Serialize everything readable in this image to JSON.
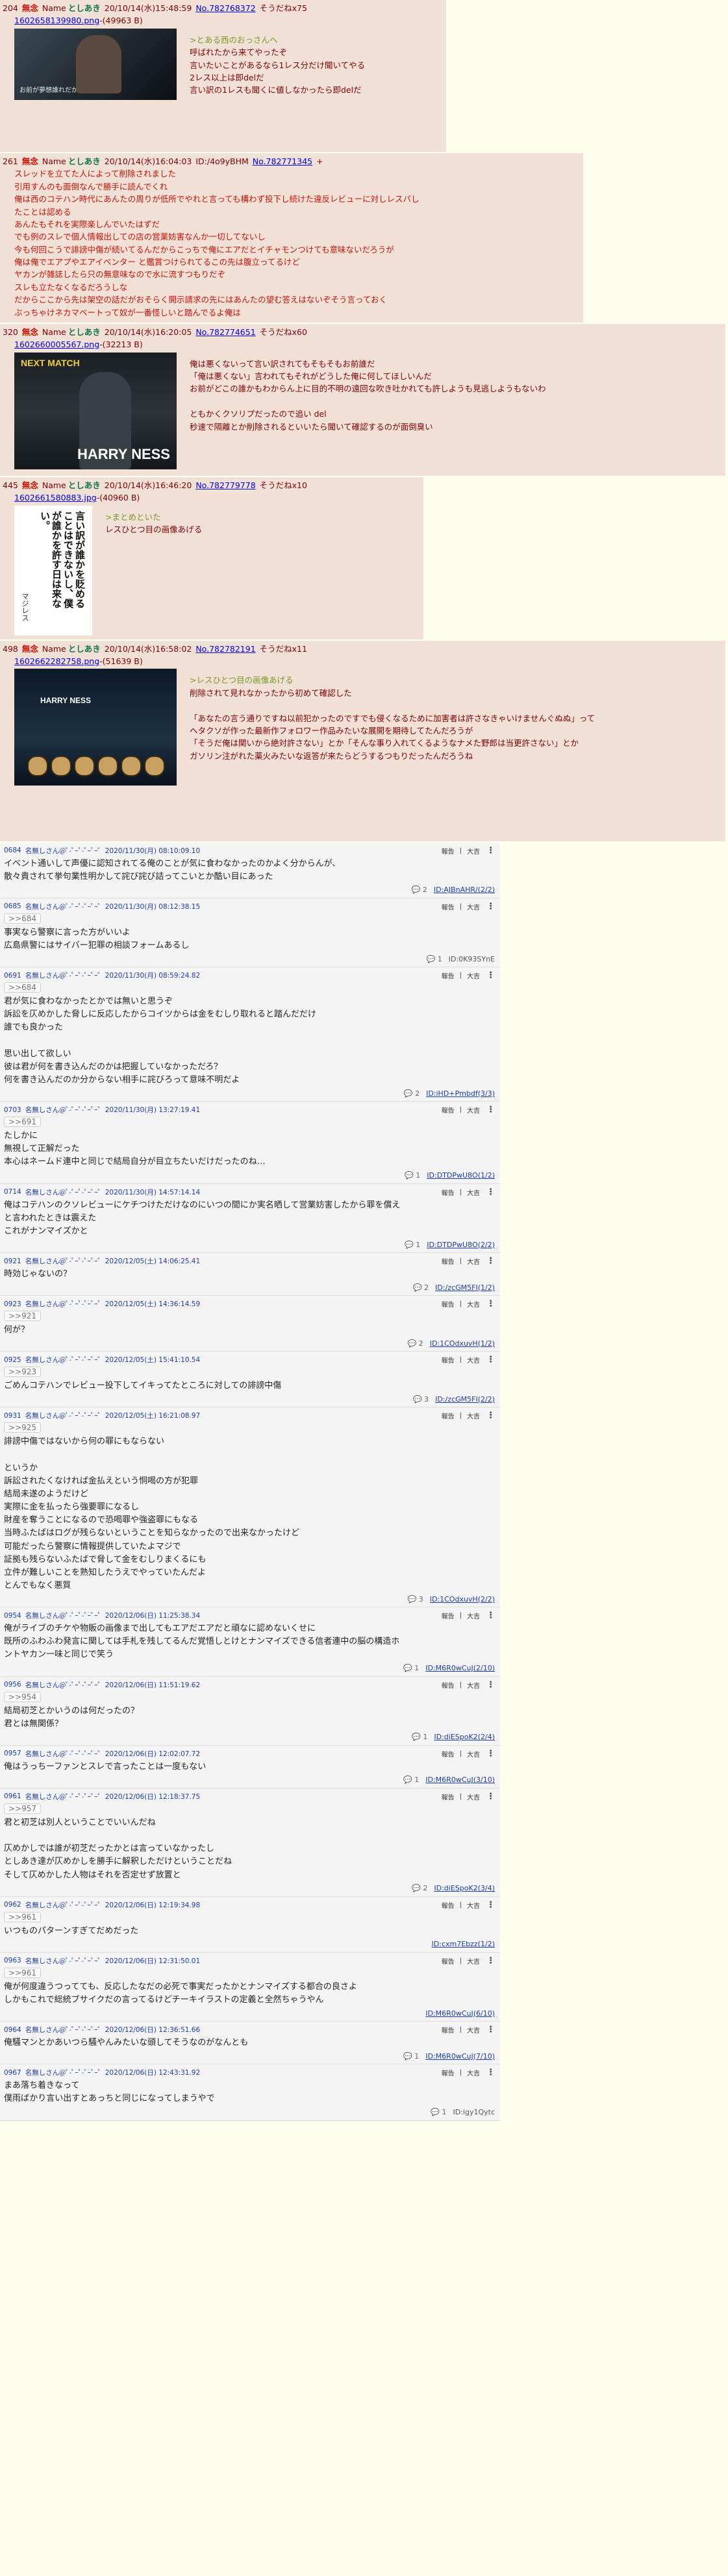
{
  "chan_posts": [
    {
      "num": "204",
      "subject": "無念",
      "name_label": "Name",
      "name": "としあき",
      "datetime": "20/10/14(水)15:48:59",
      "no": "No.782768372",
      "del": "そうだねx75",
      "file": "1602658139980.png",
      "fsize": "-(49963 B)",
      "img_caption": "お前が夢想誰れだかお前わ ...",
      "lines": [
        {
          "t": "q",
          "s": ">とある西のおっさんへ"
        },
        {
          "t": "n",
          "s": "呼ばれたから来てやったぞ"
        },
        {
          "t": "n",
          "s": "言いたいことがあるなら1レス分だけ聞いてやる"
        },
        {
          "t": "n",
          "s": "2レス以上は即delだ"
        },
        {
          "t": "n",
          "s": "言い訳の1レスも聞くに値しなかったら即delだ"
        }
      ]
    },
    {
      "num": "261",
      "subject": "無念",
      "name_label": "Name",
      "name": "としあき",
      "datetime": "20/10/14(水)16:04:03",
      "id": "ID:/4o9yBHM",
      "no": "No.782771345",
      "plus": "+",
      "lines": [
        {
          "t": "r",
          "s": "スレッドを立てた人によって削除されました"
        },
        {
          "t": "r",
          "s": "引用すんのも面倒なんで勝手に読んでくれ"
        },
        {
          "t": "r",
          "s": "俺は西のコテハン時代にあんたの周りが低所でやれと言っても構わず投下し続けた違反レビューに対しレスバし"
        },
        {
          "t": "r",
          "s": "たことは認める"
        },
        {
          "t": "r",
          "s": "あんたもそれを実際楽しんでいたはずだ"
        },
        {
          "t": "r",
          "s": "でも例のスレで個人情報出しての店の営業妨害なんか一切してないし"
        },
        {
          "t": "r",
          "s": "今も何回こうで誹謗中傷が続いてるんだからこっちで俺にエアだとイチャモンつけても意味ないだろうが"
        },
        {
          "t": "r",
          "s": "俺は俺でエアプやエアイベンター と鑑賞つけられてるこの先は腹立ってるけど"
        },
        {
          "t": "r",
          "s": "ヤカンが雑誌したら只の無意味なので水に流すつもりだぞ"
        },
        {
          "t": "r",
          "s": "スレも立たなくなるだろうしな"
        },
        {
          "t": "r",
          "s": "だからここから先は架空の話だがおそらく開示請求の先にはあんたの望む答えはないぞそう言っておく"
        },
        {
          "t": "r",
          "s": "ぶっちゃけネカマベートって奴が一番怪しいと踏んでるよ俺は"
        }
      ]
    },
    {
      "num": "320",
      "subject": "無念",
      "name_label": "Name",
      "name": "としあき",
      "datetime": "20/10/14(水)16:20:05",
      "no": "No.782774651",
      "del": "そうだねx60",
      "file": "1602660005567.png",
      "fsize": "-(32213 B)",
      "img_top": "NEXT MATCH",
      "img_name": "HARRY NESS",
      "lines": [
        {
          "t": "n",
          "s": "俺は悪くないって言い訳されてもそもそもお前誰だ"
        },
        {
          "t": "n",
          "s": "「俺は悪くない」言われてもそれがどうした俺に何してほしいんだ"
        },
        {
          "t": "n",
          "s": "お前がどこの誰かもわからん上に目的不明の遠回な吹き吐かれても許しようも見逃しようもないわ"
        },
        {
          "t": "n",
          "s": " "
        },
        {
          "t": "n",
          "s": "ともかくクソリプだったので追い del"
        },
        {
          "t": "n",
          "s": "秒速で隔離とか削除されるといいたら聞いて確認するのが面倒臭い"
        }
      ]
    },
    {
      "num": "445",
      "subject": "無念",
      "name_label": "Name",
      "name": "としあき",
      "datetime": "20/10/14(水)16:46:20",
      "no": "No.782779778",
      "del": "そうだねx10",
      "file": "1602661580883.jpg",
      "fsize": "-(40960 B)",
      "img_text": "言い訳が誰かを貶めることはできないし、僕が誰かを許す日は来ない。",
      "img_sig": "マジレス",
      "lines": [
        {
          "t": "q",
          "s": ">まとめといた"
        },
        {
          "t": "n",
          "s": "レスひとつ目の画像あげる"
        }
      ]
    },
    {
      "num": "498",
      "subject": "無念",
      "name_label": "Name",
      "name": "としあき",
      "datetime": "20/10/14(水)16:58:02",
      "no": "No.782782191",
      "del": "そうだねx11",
      "file": "1602662282758.png",
      "fsize": "-(51639 B)",
      "img_name": "HARRY NESS",
      "lines": [
        {
          "t": "q",
          "s": ">レスひとつ目の画像あげる"
        },
        {
          "t": "n",
          "s": "削除されて見れなかったから初めて確認した"
        },
        {
          "t": "n",
          "s": " "
        },
        {
          "t": "n",
          "s": "「あなたの言う通りですね以前犯かったのですでも侵くなるために加害者は許さなきゃいけませんぐぬぬ」って"
        },
        {
          "t": "n",
          "s": "ヘタクソが作った最新作フォロワー作品みたいな展開を期待してたんだろうが"
        },
        {
          "t": "n",
          "s": "「そうだ俺は関いから絶対許さない」とか「そんな事り入れてくるようなナメた野郎は当更許さない」とか"
        },
        {
          "t": "n",
          "s": "ガソリン注がれた薬火みたいな返答が来たらどうするつもりだったんだろうね"
        }
      ]
    }
  ],
  "res_posts": [
    {
      "no": "0684",
      "name": "名無しさん@ﾟ-ﾟｰﾟ-ﾟｰﾟｰﾟ",
      "date": "2020/11/30(月) 08:10:09.10",
      "quote": "",
      "body": "イベント通いして声優に認知されてる俺のことが気に食わなかったのかよく分からんが、\n散々貴されて挙句業性明かして詫び詫び詰ってこいとか酷い目にあった",
      "count": "2",
      "uid": "ID:AJBnAHR/(2/2)"
    },
    {
      "no": "0685",
      "name": "名無しさん@ﾟ-ﾟｰﾟ-ﾟｰﾟｰﾟ",
      "date": "2020/11/30(月) 08:12:38.15",
      "quote": ">>684",
      "body": "事実なら警察に言った方がいいよ\n広島県警にはサイバー犯罪の相談フォームあるし",
      "count": "1",
      "uid": "ID:0K93SYnE",
      "uid_plain": true
    },
    {
      "no": "0691",
      "name": "名無しさん@ﾟ-ﾟｰﾟ-ﾟｰﾟｰﾟ",
      "date": "2020/11/30(月) 08:59:24.82",
      "quote": ">>684",
      "body": "君が気に食わなかったとかでは無いと思うぞ\n訴訟を仄めかした脅しに反応したからコイツからは金をむしり取れると踏んだだけ\n誰でも良かった\n\n思い出して欲しい\n彼は君が何を書き込んだのかは把握していなかっただろ？\n何を書き込んだのか分からない相手に詫びろって意味不明だよ",
      "count": "2",
      "uid": "ID:iHD+Pmbdf(3/3)"
    },
    {
      "no": "0703",
      "name": "名無しさん@ﾟ-ﾟｰﾟ-ﾟｰﾟｰﾟ",
      "date": "2020/11/30(月) 13:27:19.41",
      "quote": ">>691",
      "body": "たしかに\n無視して正解だった\n本心はネームド連中と同じで結局自分が目立ちたいだけだったのね…",
      "count": "1",
      "uid": "ID:DTDPwU8O(1/2)"
    },
    {
      "no": "0714",
      "name": "名無しさん@ﾟ-ﾟｰﾟ-ﾟｰﾟｰﾟ",
      "date": "2020/11/30(月) 14:57:14.14",
      "quote": "",
      "body": "俺はコテハンのクソレビューにケチつけただけなのにいつの間にか実名晒して営業妨害したから罪を償え\nと言われたときは震えた\nこれがナンマイズかと",
      "count": "1",
      "uid": "ID:DTDPwU8O(2/2)"
    },
    {
      "no": "0921",
      "name": "名無しさん@ﾟ-ﾟｰﾟ-ﾟｰﾟｰﾟ",
      "date": "2020/12/05(土) 14:06:25.41",
      "quote": "",
      "body": "時効じゃないの？",
      "count": "2",
      "uid": "ID:/zcGM5FI(1/2)"
    },
    {
      "no": "0923",
      "name": "名無しさん@ﾟ-ﾟｰﾟ-ﾟｰﾟｰﾟ",
      "date": "2020/12/05(土) 14:36:14.59",
      "quote": ">>921",
      "body": "何が？",
      "count": "2",
      "uid": "ID:1COdxuvH(1/2)"
    },
    {
      "no": "0925",
      "name": "名無しさん@ﾟ-ﾟｰﾟ-ﾟｰﾟｰﾟ",
      "date": "2020/12/05(土) 15:41:10.54",
      "quote": ">>923",
      "body": "ごめんコテハンでレビュー投下してイキってたところに対しての誹謗中傷",
      "count": "3",
      "uid": "ID:/zcGM5FI(2/2)"
    },
    {
      "no": "0931",
      "name": "名無しさん@ﾟ-ﾟｰﾟ-ﾟｰﾟｰﾟ",
      "date": "2020/12/05(土) 16:21:08.97",
      "quote": ">>925",
      "body": "誹謗中傷ではないから何の罪にもならない\n\nというか\n訴訟されたくなければ金払えという恫喝の方が犯罪\n結局未遂のようだけど\n実際に金を払ったら強要罪になるし\n財産を奪うことになるので恐喝罪や強盗罪にもなる\n当時ふたばはログが残らないということを知らなかったので出来なかったけど\n可能だったら警察に情報提供していたよマジで\n証拠も残らないふたばで脅して金をむしりまくるにも\n立件が難しいことを熟知したうえでやっていたんだよ\nとんでもなく悪質",
      "count": "3",
      "uid": "ID:1COdxuvH(2/2)"
    },
    {
      "no": "0954",
      "name": "名無しさん@ﾟ-ﾟｰﾟ-ﾟｰﾟｰﾟ",
      "date": "2020/12/06(日) 11:25:38.34",
      "quote": "",
      "body": "俺がライブのチケや物販の画像まで出してもエアだエアだと頑なに認めないくせに\n既所のふわふわ発言に関しては手札を残してるんだ覚悟しとけとナンマイズできる信者連中の脳の構造ホ\nントヤカン一味と同じで笑う",
      "count": "1",
      "uid": "ID:M6R0wCuJ(2/10)"
    },
    {
      "no": "0956",
      "name": "名無しさん@ﾟ-ﾟｰﾟ-ﾟｰﾟｰﾟ",
      "date": "2020/12/06(日) 11:51:19.62",
      "quote": ">>954",
      "body": "結局初芝とかいうのは何だったの？\n君とは無関係？",
      "count": "1",
      "uid": "ID:diESpoK2(2/4)"
    },
    {
      "no": "0957",
      "name": "名無しさん@ﾟ-ﾟｰﾟ-ﾟｰﾟｰﾟ",
      "date": "2020/12/06(日) 12:02:07.72",
      "quote": "",
      "body": "俺はうっちーファンとスレで言ったことは一度もない",
      "count": "1",
      "uid": "ID:M6R0wCuJ(3/10)"
    },
    {
      "no": "0961",
      "name": "名無しさん@ﾟ-ﾟｰﾟ-ﾟｰﾟｰﾟ",
      "date": "2020/12/06(日) 12:18:37.75",
      "quote": ">>957",
      "body": "君と初芝は別人ということでいいんだね\n\n仄めかしでは誰が初芝だったかとは言っていなかったし\nとしあき達が仄めかしを勝手に解釈しただけということだね\nそして仄めかした人物はそれを否定せず放置と",
      "count": "2",
      "uid": "ID:diESpoK2(3/4)"
    },
    {
      "no": "0962",
      "name": "名無しさん@ﾟ-ﾟｰﾟ-ﾟｰﾟｰﾟ",
      "date": "2020/12/06(日) 12:19:34.98",
      "quote": ">>961",
      "body": "いつものパターンすぎてだめだった",
      "count": "",
      "uid": "ID:cxm7Ebzz(1/2)"
    },
    {
      "no": "0963",
      "name": "名無しさん@ﾟ-ﾟｰﾟ-ﾟｰﾟｰﾟ",
      "date": "2020/12/06(日) 12:31:50.01",
      "quote": ">>961",
      "body": "俺が何度違うつってても、反応したなだの必死で事実だったかとナンマイズする都合の良さよ\nしかもこれで総統ブサイクだの言ってるけどチーキイラストの定義と全然ちゃうやん",
      "count": "",
      "uid": "ID:M6R0wCuJ(6/10)"
    },
    {
      "no": "0964",
      "name": "名無しさん@ﾟ-ﾟｰﾟ-ﾟｰﾟｰﾟ",
      "date": "2020/12/06(日) 12:36:51.66",
      "quote": "",
      "body": "俺騒マンとかあいつら騒やんみたいな頭してそうなのがなんとも",
      "count": "1",
      "uid": "ID:M6R0wCuJ(7/10)"
    },
    {
      "no": "0967",
      "name": "名無しさん@ﾟ-ﾟｰﾟ-ﾟｰﾟｰﾟ",
      "date": "2020/12/06(日) 12:43:31.92",
      "quote": "",
      "body": "まあ落ち着きなって\n僕雨ばかり言い出すとあっちと同じになってしまうやで",
      "count": "1",
      "uid": "ID:igy1Qytc",
      "uid_plain": true
    }
  ],
  "labels": {
    "report": "報告",
    "vote": "大吉"
  }
}
